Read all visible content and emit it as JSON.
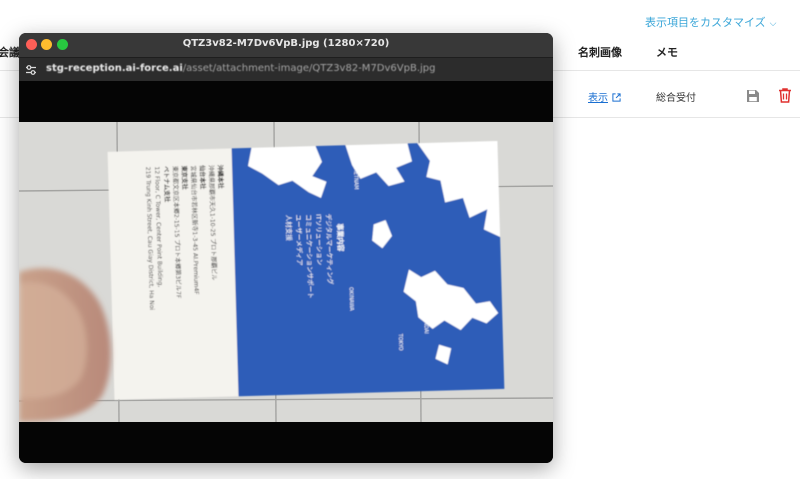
{
  "app": {
    "customize_label": "表示項目をカスタマイズ",
    "customize_chevron": "⌵",
    "columns": {
      "cut_header": "会議",
      "meishi_header": "名刺画像",
      "memo_header": "メモ"
    },
    "row": {
      "show_link": "表示",
      "memo": "総合受付"
    },
    "icons": {
      "save": "save-icon",
      "delete": "trash-icon",
      "external": "external-link-icon"
    },
    "colors": {
      "link": "#1a6fd1",
      "accent": "#3aa6d8",
      "danger": "#e0302f",
      "save_icon": "#8a8a8a"
    }
  },
  "window": {
    "title": "QTZ3v82-M7Dv6VpB.jpg (1280×720)",
    "url_domain": "stg-reception.ai-force.ai",
    "url_path": "/asset/attachment-image/QTZ3v82-M7Dv6VpB.jpg",
    "titlebar_color": "#383838",
    "traffic_lights": [
      "#fe5f57",
      "#febc2e",
      "#28c840"
    ]
  },
  "photo": {
    "card_lines": [
      "沖縄本社",
      "沖縄県那覇市天久1-10-25 プロト那覇ビル",
      "仙台本社",
      "宮城県仙台市若林区新寺1-3-45 AI.Premium4F",
      "東京支社",
      "東京都文京区本郷2-15-15 プロト本郷第3ビル7F",
      "ベトナム支社",
      "12 Floor, C Tower, Center Point Building,",
      "219 Trung Kinh Street, Cau Giay District, Ha Noi"
    ],
    "business_heading": "事業内容",
    "business_lines": [
      "デジタルマーケティング",
      "ITソリューション",
      "コミュニケーションサポート",
      "ユーザーメディア",
      "人材支援"
    ],
    "map_labels": [
      "VIETNAM",
      "OKINAWA",
      "TOKYO",
      "SENDAI"
    ],
    "colors": {
      "card_blue": "#2e5db8",
      "card_paper": "#f4f3ee",
      "tiles": "#d9d9d6",
      "grout": "#9a9a98",
      "skin": "#c9a18a"
    }
  }
}
